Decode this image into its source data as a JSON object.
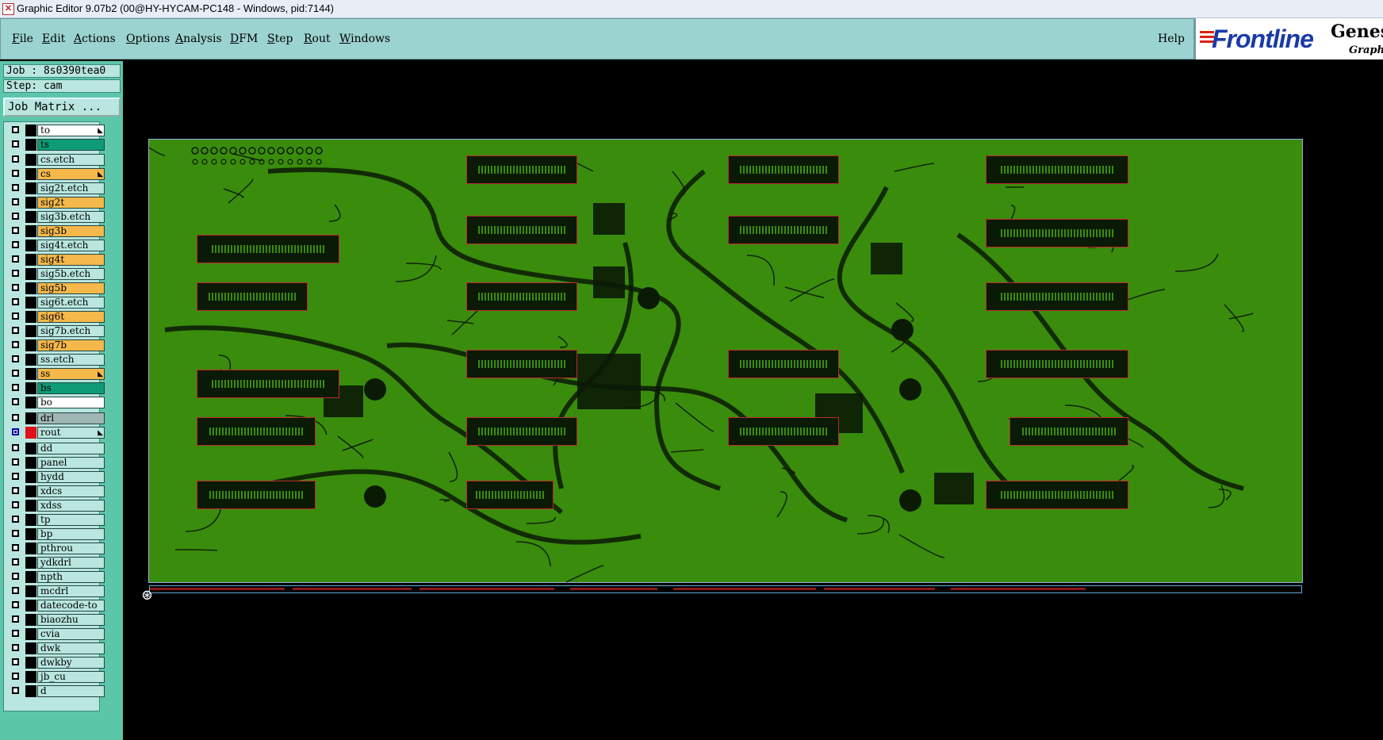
{
  "window": {
    "title": "Graphic Editor 9.07b2 (00@HY-HYCAM-PC148 - Windows, pid:7144)"
  },
  "menu": {
    "items": [
      {
        "label": "File",
        "hotkey": "F",
        "rest": "ile"
      },
      {
        "label": "Edit",
        "hotkey": "E",
        "rest": "dit"
      },
      {
        "label": "Actions",
        "hotkey": "A",
        "rest": "ctions"
      },
      {
        "label": "Options",
        "hotkey": "O",
        "rest": "ptions"
      },
      {
        "label": "Analysis",
        "hotkey": "A",
        "rest": "nalysis"
      },
      {
        "label": "DFM",
        "hotkey": "D",
        "rest": "FM"
      },
      {
        "label": "Step",
        "hotkey": "S",
        "rest": "tep"
      },
      {
        "label": "Rout",
        "hotkey": "R",
        "rest": "out"
      },
      {
        "label": "Windows",
        "hotkey": "W",
        "rest": "indows"
      }
    ],
    "help": "Help"
  },
  "brand": {
    "logo": "Frontline",
    "product": "Genesis",
    "subtitle": "Graphic"
  },
  "job": {
    "job_line": "Job : 8s0390tea0",
    "step_line": "Step: cam",
    "matrix_button": "Job Matrix ..."
  },
  "layers": [
    {
      "name": "to",
      "fill": "#ffffff",
      "swatch": "#000000",
      "arrow": true
    },
    {
      "name": "ts",
      "fill": "#0d9c76",
      "swatch": "#000000"
    },
    {
      "name": "cs.etch",
      "fill": "#b9e6df",
      "swatch": "#000000"
    },
    {
      "name": "cs",
      "fill": "#f5b84a",
      "swatch": "#000000",
      "arrow": true
    },
    {
      "name": "sig2t.etch",
      "fill": "#b9e6df",
      "swatch": "#000000"
    },
    {
      "name": "sig2t",
      "fill": "#f5b84a",
      "swatch": "#000000"
    },
    {
      "name": "sig3b.etch",
      "fill": "#b9e6df",
      "swatch": "#000000"
    },
    {
      "name": "sig3b",
      "fill": "#f5b84a",
      "swatch": "#000000"
    },
    {
      "name": "sig4t.etch",
      "fill": "#b9e6df",
      "swatch": "#000000"
    },
    {
      "name": "sig4t",
      "fill": "#f5b84a",
      "swatch": "#000000"
    },
    {
      "name": "sig5b.etch",
      "fill": "#b9e6df",
      "swatch": "#000000"
    },
    {
      "name": "sig5b",
      "fill": "#f5b84a",
      "swatch": "#000000"
    },
    {
      "name": "sig6t.etch",
      "fill": "#b9e6df",
      "swatch": "#000000"
    },
    {
      "name": "sig6t",
      "fill": "#f5b84a",
      "swatch": "#000000"
    },
    {
      "name": "sig7b.etch",
      "fill": "#b9e6df",
      "swatch": "#000000"
    },
    {
      "name": "sig7b",
      "fill": "#f5b84a",
      "swatch": "#000000"
    },
    {
      "name": "ss.etch",
      "fill": "#b9e6df",
      "swatch": "#000000"
    },
    {
      "name": "ss",
      "fill": "#f5b84a",
      "swatch": "#000000",
      "arrow": true
    },
    {
      "name": "bs",
      "fill": "#0d9c76",
      "swatch": "#000000"
    },
    {
      "name": "bo",
      "fill": "#ffffff",
      "swatch": "#000000"
    },
    {
      "name": "drl",
      "fill": "#9fb7b4",
      "swatch": "#000000"
    },
    {
      "name": "rout",
      "fill": "#b9e6df",
      "swatch": "#e0101a",
      "selected": true,
      "arrow": true
    },
    {
      "name": "dd",
      "fill": "#b9e6df",
      "swatch": "#000000"
    },
    {
      "name": "panel",
      "fill": "#b9e6df",
      "swatch": "#000000"
    },
    {
      "name": "hydd",
      "fill": "#b9e6df",
      "swatch": "#000000"
    },
    {
      "name": "xdcs",
      "fill": "#b9e6df",
      "swatch": "#000000"
    },
    {
      "name": "xdss",
      "fill": "#b9e6df",
      "swatch": "#000000"
    },
    {
      "name": "tp",
      "fill": "#b9e6df",
      "swatch": "#000000"
    },
    {
      "name": "bp",
      "fill": "#b9e6df",
      "swatch": "#000000"
    },
    {
      "name": "pthrou",
      "fill": "#b9e6df",
      "swatch": "#000000"
    },
    {
      "name": "ydkdrl",
      "fill": "#b9e6df",
      "swatch": "#000000"
    },
    {
      "name": "npth",
      "fill": "#b9e6df",
      "swatch": "#000000"
    },
    {
      "name": "mcdrl",
      "fill": "#b9e6df",
      "swatch": "#000000"
    },
    {
      "name": "datecode-to",
      "fill": "#b9e6df",
      "swatch": "#000000"
    },
    {
      "name": "biaozhu",
      "fill": "#b9e6df",
      "swatch": "#000000"
    },
    {
      "name": "cvia",
      "fill": "#b9e6df",
      "swatch": "#000000"
    },
    {
      "name": "dwk",
      "fill": "#b9e6df",
      "swatch": "#000000"
    },
    {
      "name": "dwkby",
      "fill": "#b9e6df",
      "swatch": "#000000"
    },
    {
      "name": "jb_cu",
      "fill": "#b9e6df",
      "swatch": "#000000"
    },
    {
      "name": "d",
      "fill": "#b9e6df",
      "swatch": "#000000"
    }
  ],
  "colors": {
    "board": "#3a8c0c",
    "trace": "#0b1a05",
    "connector_outline": "#c1272d",
    "panel_bg": "#5cc6a9",
    "menu_bg": "#9bd3d0"
  },
  "icons": {
    "title": "app-icon",
    "origin": "crosshair-icon"
  }
}
